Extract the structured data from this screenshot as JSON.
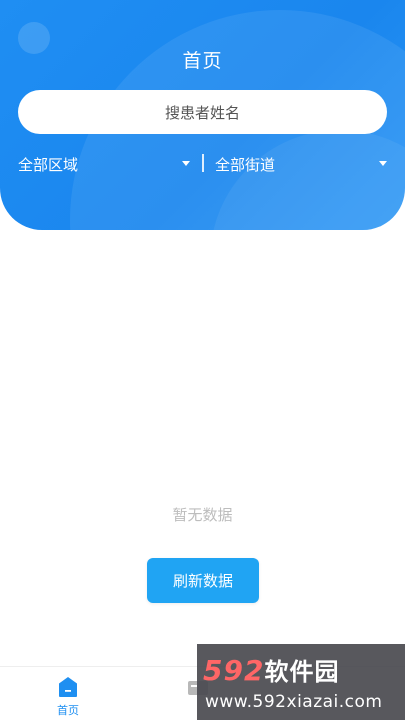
{
  "header": {
    "title": "首页",
    "accent_color": "#1a86ee"
  },
  "search": {
    "placeholder": "搜患者姓名"
  },
  "filters": {
    "region": {
      "label": "全部区域",
      "icon": "caret-down-icon"
    },
    "street": {
      "label": "全部街道",
      "icon": "caret-down-icon"
    }
  },
  "empty_state": {
    "message": "暂无数据",
    "refresh_label": "刷新数据",
    "button_color": "#20a4f3"
  },
  "tabbar": {
    "items": [
      {
        "label": "首页",
        "icon": "home-icon",
        "active": true
      },
      {
        "label": "",
        "icon": "card-icon",
        "active": false
      }
    ]
  },
  "watermark": {
    "number": "592",
    "text": "软件园",
    "url": "www.592xiazai.com"
  }
}
